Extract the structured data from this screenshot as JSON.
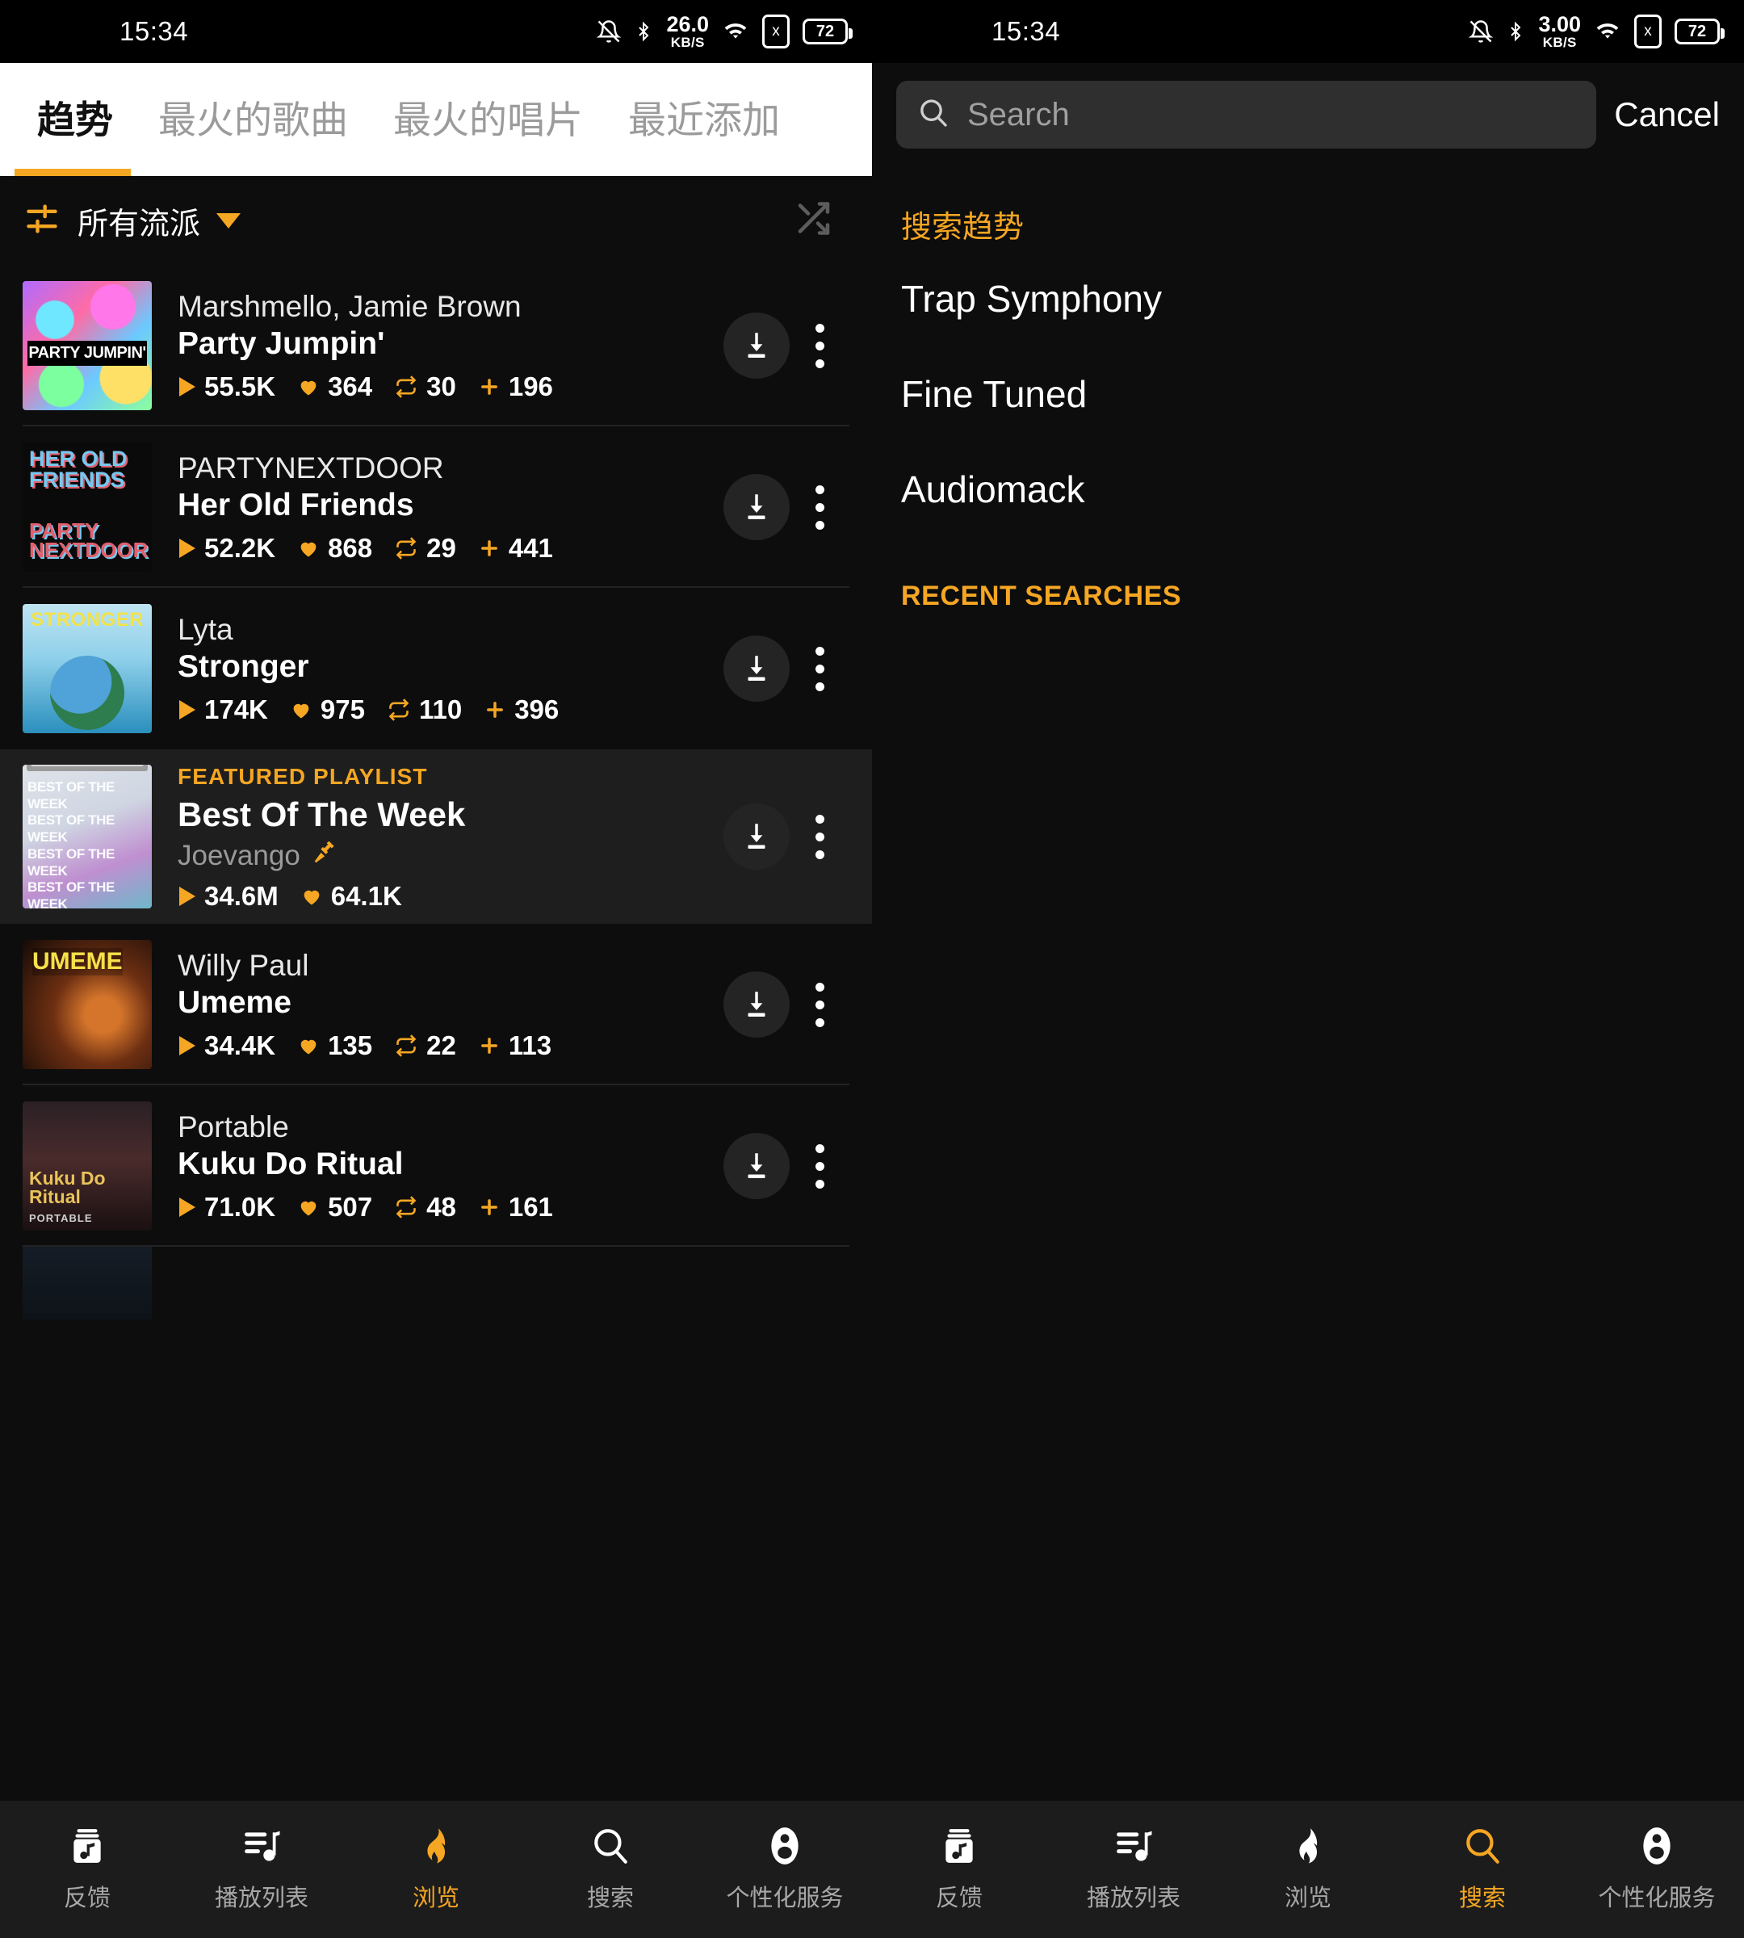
{
  "status_bar": {
    "time": "15:34",
    "left_net_speed_value": "26.0",
    "left_net_speed_unit": "KB/S",
    "right_net_speed_value": "3.00",
    "right_net_speed_unit": "KB/S",
    "battery": "72",
    "sim_label": "x",
    "icons": [
      "notifications-off-icon",
      "bluetooth-icon",
      "network-speed",
      "wifi-icon",
      "sim-card-icon",
      "battery-icon"
    ]
  },
  "theme": {
    "accent": "#f5a623",
    "background": "#0d0d0d",
    "surface": "#1e1e1e",
    "nav_background": "#1c1c1c",
    "text_primary": "#ffffff",
    "text_secondary": "#9a9a9a"
  },
  "left_panel": {
    "tabs": [
      {
        "label": "趋势",
        "active": true
      },
      {
        "label": "最火的歌曲",
        "active": false
      },
      {
        "label": "最火的唱片",
        "active": false
      },
      {
        "label": "最近添加",
        "active": false
      }
    ],
    "filter": {
      "icon": "sliders-icon",
      "label": "所有流派",
      "caret": "chevron-down-icon",
      "shuffle_icon": "shuffle-icon"
    },
    "tracks": [
      {
        "artist": "Marshmello, Jamie Brown",
        "title": "Party Jumpin'",
        "plays": "55.5K",
        "likes": "364",
        "reposts": "30",
        "adds": "196",
        "art": "party-jumpin-cover"
      },
      {
        "artist": "PARTYNEXTDOOR",
        "title": "Her Old Friends",
        "plays": "52.2K",
        "likes": "868",
        "reposts": "29",
        "adds": "441",
        "art": "her-old-friends-cover"
      },
      {
        "artist": "Lyta",
        "title": "Stronger",
        "plays": "174K",
        "likes": "975",
        "reposts": "110",
        "adds": "396",
        "art": "stronger-cover"
      },
      {
        "kicker": "FEATURED PLAYLIST",
        "title": "Best Of The Week",
        "owner": "Joevango",
        "owner_badge": "verified-plug-icon",
        "plays": "34.6M",
        "likes": "64.1K",
        "featured": true,
        "art": "best-of-the-week-cover"
      },
      {
        "artist": "Willy Paul",
        "title": "Umeme",
        "plays": "34.4K",
        "likes": "135",
        "reposts": "22",
        "adds": "113",
        "art": "umeme-cover"
      },
      {
        "artist": "Portable",
        "title": "Kuku Do Ritual",
        "plays": "71.0K",
        "likes": "507",
        "reposts": "48",
        "adds": "161",
        "art": "kuku-do-ritual-cover"
      }
    ],
    "row_actions": {
      "download_icon": "download-icon",
      "menu_icon": "more-vertical-icon"
    }
  },
  "right_panel": {
    "search": {
      "placeholder": "Search",
      "value": "",
      "icon": "search-icon",
      "cancel_label": "Cancel"
    },
    "trending_header": "搜索趋势",
    "trending": [
      {
        "label": "Trap Symphony"
      },
      {
        "label": "Fine Tuned"
      },
      {
        "label": "Audiomack"
      }
    ],
    "recent_header": "RECENT SEARCHES",
    "recent": []
  },
  "bottom_nav_left": {
    "items": [
      {
        "label": "反馈",
        "icon": "music-feed-icon",
        "active": false
      },
      {
        "label": "播放列表",
        "icon": "playlist-icon",
        "active": false
      },
      {
        "label": "浏览",
        "icon": "flame-icon",
        "active": true
      },
      {
        "label": "搜索",
        "icon": "search-icon",
        "active": false
      },
      {
        "label": "个性化服务",
        "icon": "account-icon",
        "active": false
      }
    ]
  },
  "bottom_nav_right": {
    "items": [
      {
        "label": "反馈",
        "icon": "music-feed-icon",
        "active": false
      },
      {
        "label": "播放列表",
        "icon": "playlist-icon",
        "active": false
      },
      {
        "label": "浏览",
        "icon": "flame-icon",
        "active": false
      },
      {
        "label": "搜索",
        "icon": "search-icon",
        "active": true
      },
      {
        "label": "个性化服务",
        "icon": "account-icon",
        "active": false
      }
    ]
  },
  "stat_icons": {
    "plays": "play-triangle-icon",
    "likes": "heart-icon",
    "reposts": "repost-icon",
    "adds": "plus-icon"
  }
}
